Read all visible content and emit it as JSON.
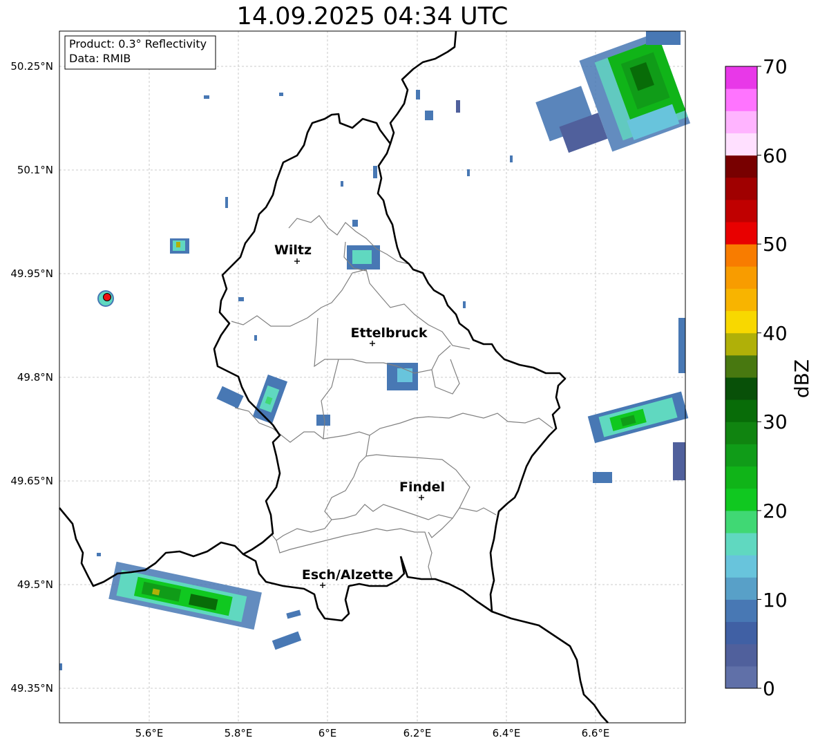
{
  "title": "14.09.2025 04:34 UTC",
  "info_box": {
    "product": "Product: 0.3° Reflectivity",
    "data": "Data: RMIB"
  },
  "lat_labels": [
    "50.25°N",
    "50.1°N",
    "49.95°N",
    "49.8°N",
    "49.65°N",
    "49.5°N",
    "49.35°N"
  ],
  "lon_labels": [
    "5.6°E",
    "5.8°E",
    "6°E",
    "6.2°E",
    "6.4°E",
    "6.6°E"
  ],
  "cities": [
    {
      "name": "Wiltz"
    },
    {
      "name": "Ettelbruck"
    },
    {
      "name": "Findel"
    },
    {
      "name": "Esch/Alzette"
    }
  ],
  "colorbar": {
    "label": "dBZ",
    "ticks": [
      "0",
      "10",
      "20",
      "30",
      "40",
      "50",
      "60",
      "70"
    ],
    "colors": [
      "#6070a8",
      "#50609c",
      "#4060a4",
      "#4878b4",
      "#58a0c8",
      "#68c4dc",
      "#60d8c0",
      "#40d874",
      "#10c820",
      "#10b418",
      "#109c18",
      "#108410",
      "#086c08",
      "#085008",
      "#487810",
      "#b0b008",
      "#f8d800",
      "#f8b400",
      "#f89c00",
      "#f87c00",
      "#e80000",
      "#c00000",
      "#a00000",
      "#780000",
      "#ffe0ff",
      "#ffb4ff",
      "#ff74ff",
      "#e838e8"
    ]
  },
  "colors": {
    "border_country": "#000000",
    "border_canton": "#808080",
    "grid": "#bbbbbb",
    "radar_site": "#ee1111"
  }
}
